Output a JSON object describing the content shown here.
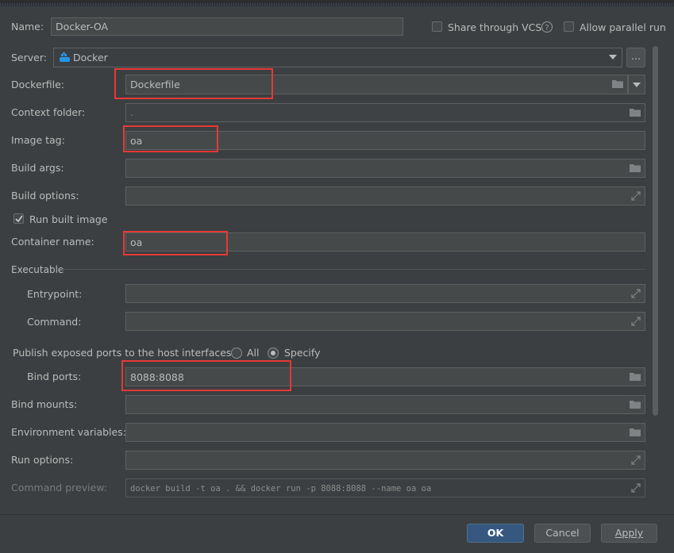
{
  "header": {
    "name_label": "Name:",
    "name_value": "Docker-OA",
    "share_vcs_label": "Share through VCS",
    "allow_parallel_label": "Allow parallel run"
  },
  "server": {
    "label": "Server:",
    "value": "Docker",
    "more_label": "..."
  },
  "fields": {
    "dockerfile": {
      "label": "Dockerfile:",
      "value": "Dockerfile"
    },
    "context_folder": {
      "label": "Context folder:",
      "value": "."
    },
    "image_tag": {
      "label": "Image tag:",
      "value": "oa"
    },
    "build_args": {
      "label": "Build args:",
      "value": ""
    },
    "build_options": {
      "label": "Build options:",
      "value": ""
    },
    "run_built_image": {
      "label": "Run built image",
      "checked": true
    },
    "container_name": {
      "label": "Container name:",
      "value": "oa"
    },
    "executable_section": "Executable",
    "entrypoint": {
      "label": "Entrypoint:",
      "value": ""
    },
    "command": {
      "label": "Command:",
      "value": ""
    },
    "publish_ports": {
      "label": "Publish exposed ports to the host interfaces:",
      "all_label": "All",
      "specify_label": "Specify",
      "selected": "Specify"
    },
    "bind_ports": {
      "label": "Bind ports:",
      "value": "8088:8088"
    },
    "bind_mounts": {
      "label": "Bind mounts:",
      "value": ""
    },
    "env_vars": {
      "label": "Environment variables:",
      "value": ""
    },
    "run_options": {
      "label": "Run options:",
      "value": ""
    },
    "command_preview": {
      "label": "Command preview:",
      "value": "docker build -t oa . && docker run -p 8088:8088 --name oa oa"
    }
  },
  "buttons": {
    "ok": "OK",
    "cancel": "Cancel",
    "apply": "Apply"
  },
  "colors": {
    "background": "#3c3f41",
    "field": "#45494a",
    "highlight": "#e53935",
    "ok_button": "#365880",
    "docker_blue": "#2496ed"
  }
}
